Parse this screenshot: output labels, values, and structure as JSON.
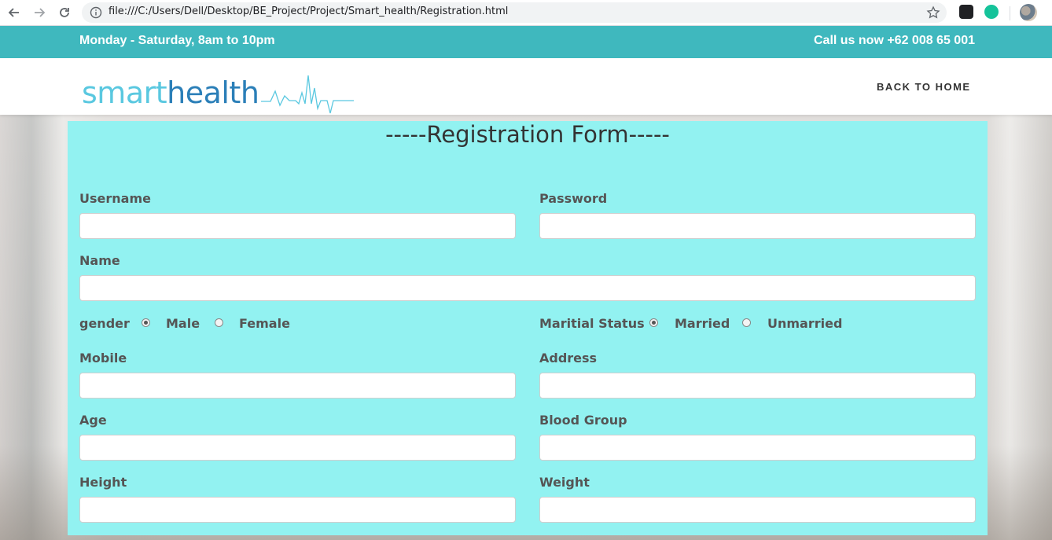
{
  "browser": {
    "url": "file:///C:/Users/Dell/Desktop/BE_Project/Project/Smart_health/Registration.html"
  },
  "topbar": {
    "hours": "Monday - Saturday, 8am to 10pm",
    "phone": "Call us now +62 008 65 001"
  },
  "header": {
    "logo_smart": "smart",
    "logo_health": "health",
    "back_home": "BACK TO HOME"
  },
  "form": {
    "title": "-----Registration Form-----",
    "username_label": "Username",
    "username_value": "",
    "password_label": "Password",
    "password_value": "",
    "name_label": "Name",
    "name_value": "",
    "gender_label": "gender",
    "gender_options": [
      "Male",
      "Female"
    ],
    "gender_selected": "Male",
    "marital_label": "Maritial Status",
    "marital_options": [
      "Married",
      "Unmarried"
    ],
    "marital_selected": "Married",
    "mobile_label": "Mobile",
    "mobile_value": "",
    "address_label": "Address",
    "address_value": "",
    "age_label": "Age",
    "age_value": "",
    "blood_label": "Blood Group",
    "blood_value": "",
    "height_label": "Height",
    "height_value": "",
    "weight_label": "Weight",
    "weight_value": ""
  },
  "colors": {
    "topbar": "#3fb8be",
    "form_background": "#92f2f1",
    "logo_smart": "#5ac8e0",
    "logo_health": "#2b7fb8"
  }
}
